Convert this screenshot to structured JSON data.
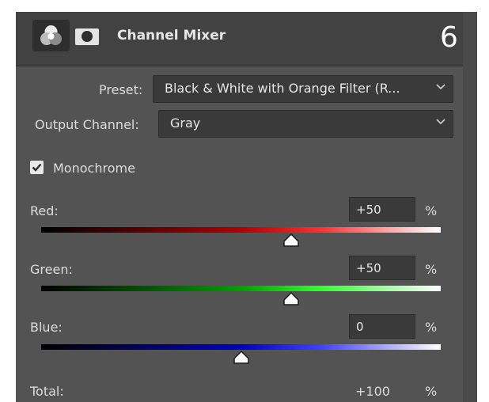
{
  "panel": {
    "title": "Channel Mixer",
    "step_number": "6"
  },
  "preset": {
    "label": "Preset:",
    "value": "Black & White with Orange Filter (R..."
  },
  "output_channel": {
    "label": "Output Channel:",
    "value": "Gray"
  },
  "monochrome": {
    "label": "Monochrome",
    "checked": true
  },
  "sliders": [
    {
      "label": "Red:",
      "value": "+50",
      "unit": "%",
      "level_fraction": 0.625
    },
    {
      "label": "Green:",
      "value": "+50",
      "unit": "%",
      "level_fraction": 0.625
    },
    {
      "label": "Blue:",
      "value": "0",
      "unit": "%",
      "level_fraction": 0.5
    }
  ],
  "total": {
    "label": "Total:",
    "value": "+100",
    "unit": "%"
  },
  "icons": [
    "channel-mixer-icon",
    "layer-mask-icon",
    "chevron-down-icon",
    "checkmark-icon",
    "slider-thumb-icon"
  ]
}
